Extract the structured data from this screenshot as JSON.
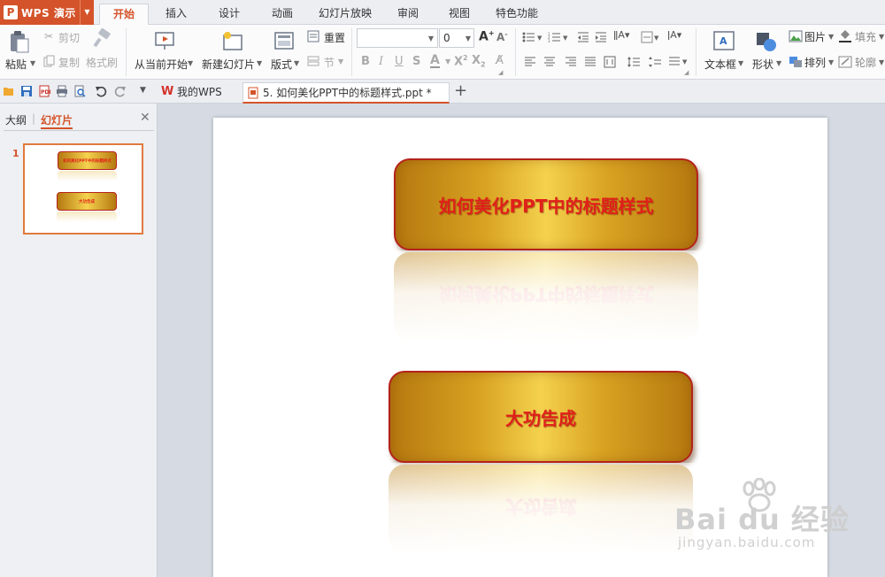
{
  "app": {
    "name": "WPS 演示",
    "logo_letter": "P"
  },
  "menu_tabs": [
    "开始",
    "插入",
    "设计",
    "动画",
    "幻灯片放映",
    "审阅",
    "视图",
    "特色功能"
  ],
  "active_menu_tab": "开始",
  "ribbon": {
    "paste": "粘贴",
    "cut": "剪切",
    "copy": "复制",
    "format_painter": "格式刷",
    "from_current": "从当前开始",
    "new_slide": "新建幻灯片",
    "layout": "版式",
    "reset": "重置",
    "section": "节",
    "font_name": "",
    "font_size": "0",
    "textbox": "文本框",
    "shape": "形状",
    "picture": "图片",
    "fill": "填充",
    "arrange": "排列",
    "outline": "轮廓"
  },
  "doc_tabs": [
    {
      "label": "我的WPS"
    },
    {
      "label": "5. 如何美化PPT中的标题样式.ppt *"
    }
  ],
  "left_panel": {
    "tab_outline": "大纲",
    "tab_slides": "幻灯片",
    "slide_number": "1"
  },
  "slide": {
    "title_text": "如何美化PPT中的标题样式",
    "subtitle_text": "大功告成",
    "accent_color": "#e0201a",
    "box_border_color": "#b4221b",
    "gold_color": "#e8b935"
  },
  "watermark": {
    "brand": "Bai du 经验",
    "url": "jingyan.baidu.com"
  }
}
